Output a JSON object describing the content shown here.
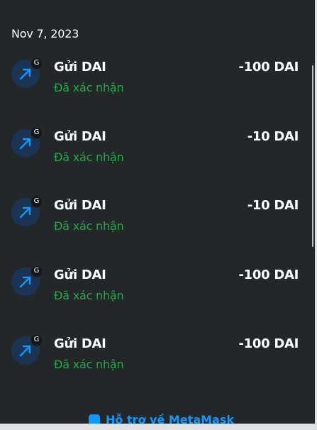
{
  "date_header": "Nov 7, 2023",
  "transactions": [
    {
      "title": "Gửi DAI",
      "status": "Đã xác nhận",
      "amount": "-100 DAI",
      "badge": "G",
      "icon": "arrow-up-right-icon"
    },
    {
      "title": "Gửi DAI",
      "status": "Đã xác nhận",
      "amount": "-10 DAI",
      "badge": "G",
      "icon": "arrow-up-right-icon"
    },
    {
      "title": "Gửi DAI",
      "status": "Đã xác nhận",
      "amount": "-10 DAI",
      "badge": "G",
      "icon": "arrow-up-right-icon"
    },
    {
      "title": "Gửi DAI",
      "status": "Đã xác nhận",
      "amount": "-100 DAI",
      "badge": "G",
      "icon": "arrow-up-right-icon"
    },
    {
      "title": "Gửi DAI",
      "status": "Đã xác nhận",
      "amount": "-100 DAI",
      "badge": "G",
      "icon": "arrow-up-right-icon"
    }
  ],
  "footer": {
    "support_link": "Hỗ trợ về MetaMask",
    "icon": "help-icon"
  },
  "colors": {
    "background": "#24272a",
    "status_confirmed": "#28a745",
    "link": "#1098fc",
    "icon_circle": "#1b3454",
    "icon_arrow": "#1098fc"
  }
}
